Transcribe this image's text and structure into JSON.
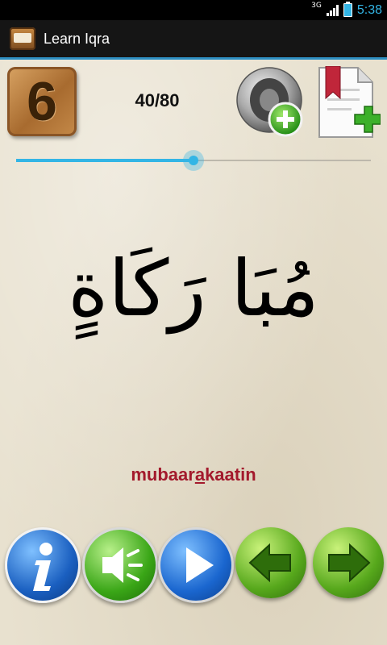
{
  "status": {
    "network": "3G",
    "time": "5:38"
  },
  "app": {
    "title": "Learn Iqra"
  },
  "lesson": {
    "level": "6",
    "progress_text": "40/80",
    "progress_fraction": 0.5
  },
  "word": {
    "arabic": "مُبَا رَكَاةٍ",
    "translit_before": "mubaar",
    "translit_highlight": "a",
    "translit_after": "kaatin"
  },
  "icons": {
    "top": [
      "speaker-add-icon",
      "bookmark-add-icon"
    ],
    "bottom": [
      "info-icon",
      "sound-icon",
      "play-icon",
      "arrow-left-icon",
      "arrow-right-icon"
    ]
  },
  "colors": {
    "accent": "#33b5e5",
    "translit": "#a3192c"
  }
}
